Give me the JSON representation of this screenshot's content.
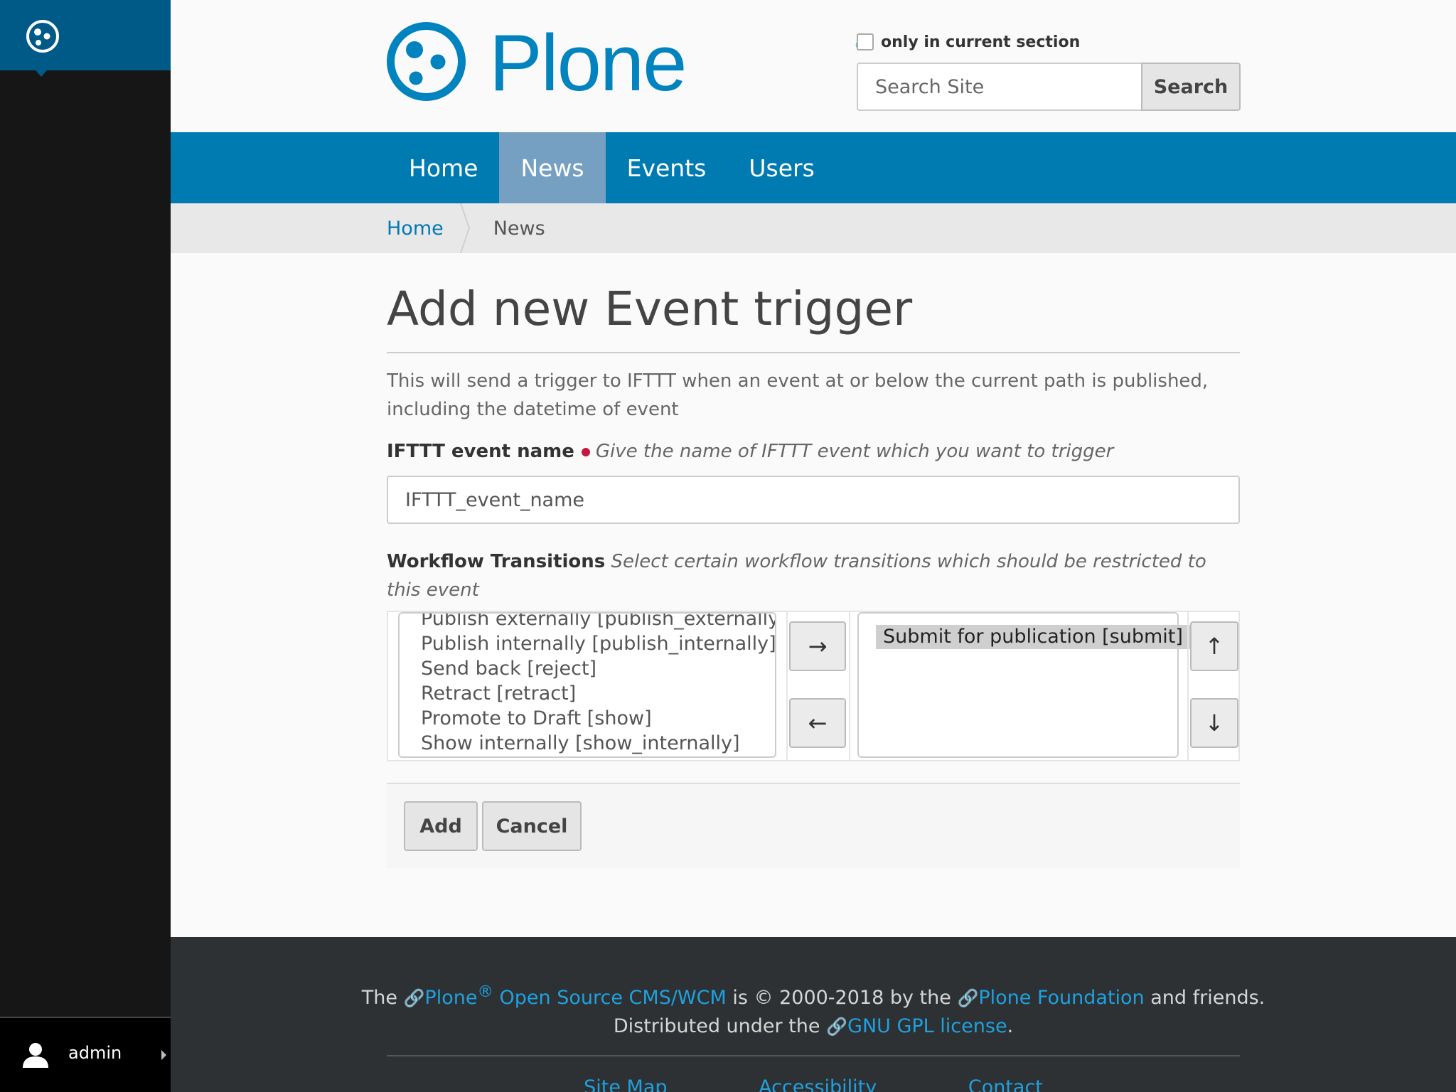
{
  "toolbar": {
    "user_name": "admin"
  },
  "header": {
    "logo_text": "Plone",
    "logo_reg": "®",
    "only_current_label": "only in current section",
    "search_placeholder": "Search Site",
    "search_button": "Search"
  },
  "nav": {
    "items": [
      {
        "label": "Home",
        "active": false
      },
      {
        "label": "News",
        "active": true
      },
      {
        "label": "Events",
        "active": false
      },
      {
        "label": "Users",
        "active": false
      }
    ]
  },
  "breadcrumb": {
    "home": "Home",
    "current": "News"
  },
  "form": {
    "title": "Add new Event trigger",
    "description": "This will send a trigger to IFTTT when an event at or below the current path is published, including the datetime of event",
    "event_name": {
      "label": "IFTTT event name",
      "help": "Give the name of IFTTT event which you want to trigger",
      "value": "IFTTT_event_name"
    },
    "transitions": {
      "label": "Workflow Transitions",
      "help": "Select certain workflow transitions which should be restricted to this event",
      "available": [
        "Publish externally [publish_externally]",
        "Publish internally [publish_internally]",
        "Send back [reject]",
        "Retract [retract]",
        "Promote to Draft [show]",
        "Show internally [show_internally]"
      ],
      "selected": [
        "Submit for publication [submit]"
      ],
      "add_arrow": "→",
      "remove_arrow": "←",
      "up_arrow": "↑",
      "down_arrow": "↓"
    },
    "add_button": "Add",
    "cancel_button": "Cancel"
  },
  "footer": {
    "t1": "The ",
    "plone": "Plone",
    "reg": "®",
    "cms": " Open Source CMS/WCM",
    "t2": " is ",
    "copy": "©",
    "t3": " 2000-2018 by the ",
    "foundation": "Plone Foundation",
    "t4": " and friends.",
    "t5": "Distributed under the ",
    "license": "GNU GPL license",
    "t6": ".",
    "links": [
      "Site Map",
      "Accessibility",
      "Contact"
    ]
  },
  "colors": {
    "toolbar_bg": "#161616",
    "toolbar_logo_bg": "#005a87",
    "brand_blue": "#0083be",
    "nav_bg": "#007bb1",
    "nav_active": "#75a0c2",
    "footer_bg": "#2e3133",
    "required_dot": "#c4183c"
  }
}
